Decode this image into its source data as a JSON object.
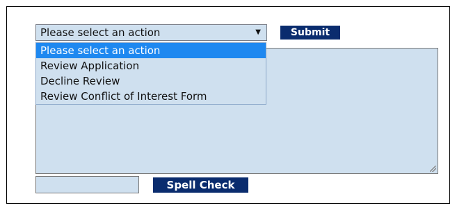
{
  "action_select": {
    "selected_label": "Please select an action",
    "arrow_icon": "▼",
    "options": [
      "Please select an action",
      "Review Application",
      "Decline Review",
      "Review Conflict of Interest Form"
    ],
    "highlighted_index": 0
  },
  "buttons": {
    "submit_label": "Submit",
    "spell_check_label": "Spell Check"
  },
  "colors": {
    "field_background": "#cfe0ef",
    "button_background": "#0a2c6e",
    "highlight": "#1e88f0"
  }
}
